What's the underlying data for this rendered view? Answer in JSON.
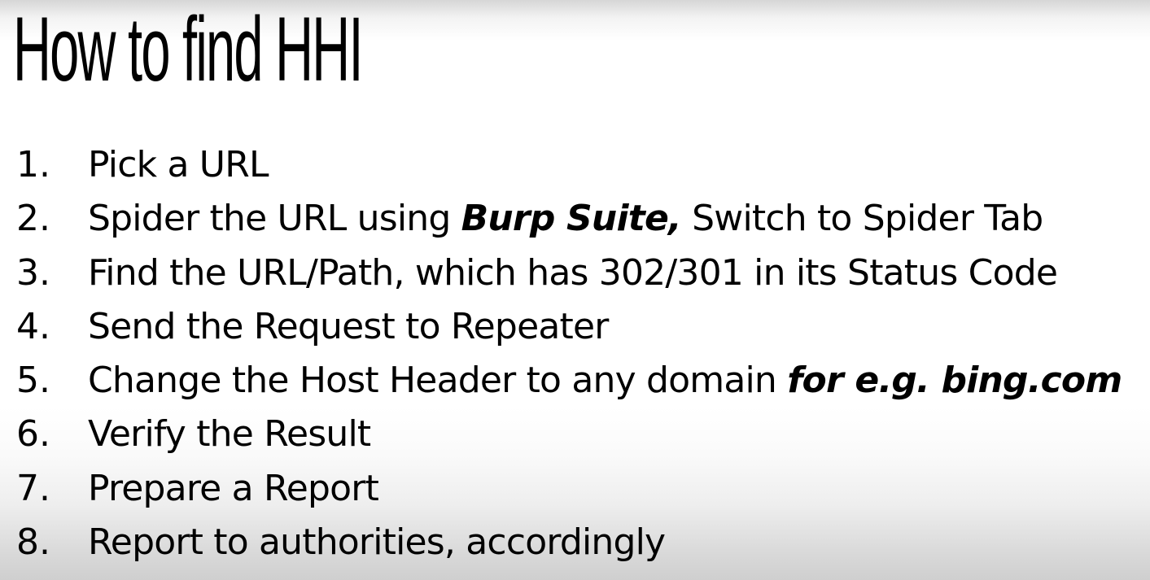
{
  "slide": {
    "title": "How to find HHI",
    "steps": [
      {
        "num": "1.",
        "parts": [
          "Pick a URL"
        ]
      },
      {
        "num": "2.",
        "parts": [
          "Spider the URL using ",
          "Burp Suite,",
          " Switch to Spider Tab"
        ]
      },
      {
        "num": "3.",
        "parts": [
          "Find the URL/Path, which has 302/301 in its Status Code"
        ]
      },
      {
        "num": "4.",
        "parts": [
          "Send the Request to Repeater"
        ]
      },
      {
        "num": "5.",
        "parts": [
          "Change the Host Header to any domain ",
          "for e.g. bing.com"
        ]
      },
      {
        "num": "6.",
        "parts": [
          "Verify the Result"
        ]
      },
      {
        "num": "7.",
        "parts": [
          "Prepare a Report"
        ]
      },
      {
        "num": "8.",
        "parts": [
          "Report to authorities, accordingly"
        ]
      }
    ]
  }
}
